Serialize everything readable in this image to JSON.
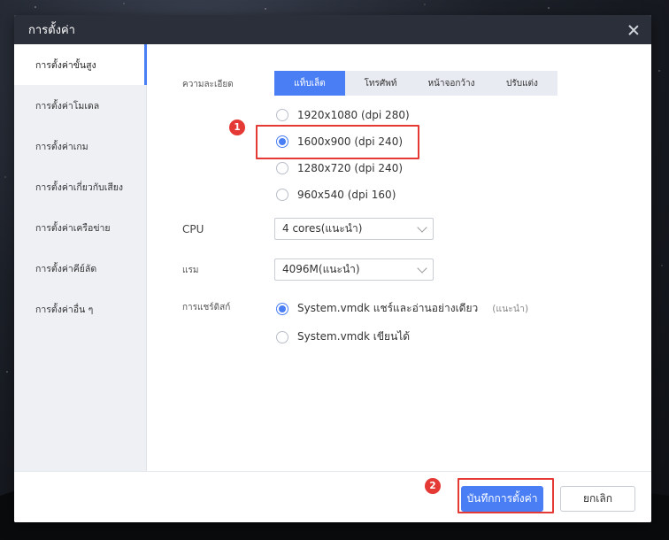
{
  "window": {
    "title": "การตั้งค่า"
  },
  "sidebar": {
    "items": [
      {
        "label": "การตั้งค่าขั้นสูง",
        "active": true
      },
      {
        "label": "การตั้งค่าโมเดล"
      },
      {
        "label": "การตั้งค่าเกม"
      },
      {
        "label": "การตั้งค่าเกี่ยวกับเสียง"
      },
      {
        "label": "การตั้งค่าเครือข่าย"
      },
      {
        "label": "การตั้งค่าคีย์ลัด"
      },
      {
        "label": "การตั้งค่าอื่น ๆ"
      }
    ]
  },
  "resolution": {
    "label": "ความละเอียด",
    "tabs": [
      {
        "label": "แท็บเล็ต",
        "active": true
      },
      {
        "label": "โทรศัพท์"
      },
      {
        "label": "หน้าจอกว้าง"
      },
      {
        "label": "ปรับแต่ง"
      }
    ],
    "options": [
      {
        "label": "1920x1080  (dpi 280)"
      },
      {
        "label": "1600x900  (dpi 240)",
        "checked": true
      },
      {
        "label": "1280x720  (dpi 240)"
      },
      {
        "label": "960x540  (dpi 160)"
      }
    ]
  },
  "cpu": {
    "label": "CPU",
    "value": "4 cores(แนะนำ)"
  },
  "ram": {
    "label": "แรม",
    "value": "4096M(แนะนำ)"
  },
  "disk": {
    "label": "การแชร์ดิสก์",
    "options": [
      {
        "label": "System.vmdk แชร์และอ่านอย่างเดียว",
        "hint": "(แนะนำ)",
        "checked": true
      },
      {
        "label": "System.vmdk เขียนได้"
      }
    ]
  },
  "footer": {
    "save_label": "บันทึกการตั้งค่า",
    "cancel_label": "ยกเลิก"
  },
  "annotations": {
    "marker1": "1",
    "marker2": "2",
    "color": "#e53935"
  },
  "colors": {
    "accent": "#4a7ef5",
    "titlebar": "#2b2f3a"
  }
}
